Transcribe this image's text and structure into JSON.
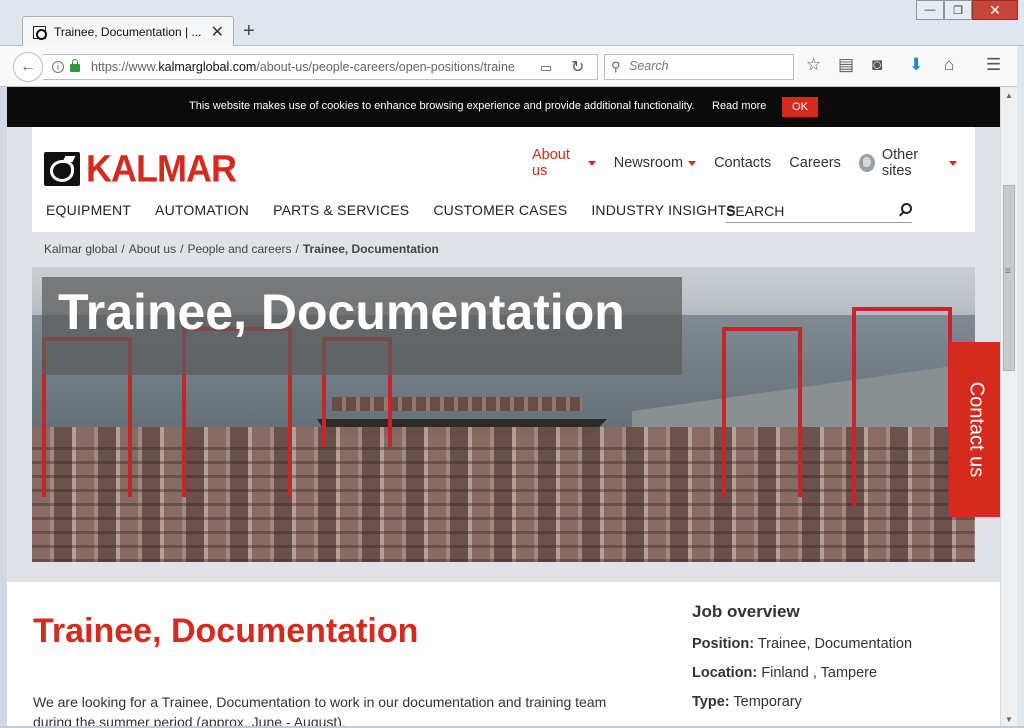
{
  "browser": {
    "tab_title": "Trainee, Documentation | ...",
    "url_prefix": "https://www.",
    "url_domain": "kalmarglobal.com",
    "url_path": "/about-us/people-careers/open-positions/traine",
    "search_placeholder": "Search"
  },
  "cookie_banner": {
    "text": "This website makes use of cookies to enhance browsing experience and provide additional functionality.",
    "read_more": "Read more",
    "ok": "OK"
  },
  "header": {
    "logo_text": "KALMAR",
    "top_nav": [
      {
        "label": "About us",
        "has_caret": true
      },
      {
        "label": "Newsroom",
        "has_caret": true
      },
      {
        "label": "Contacts",
        "has_caret": false
      },
      {
        "label": "Careers",
        "has_caret": false
      },
      {
        "label": "Other sites",
        "has_caret": true
      }
    ],
    "main_nav": [
      "EQUIPMENT",
      "AUTOMATION",
      "PARTS & SERVICES",
      "CUSTOMER CASES",
      "INDUSTRY INSIGHTS"
    ],
    "search_placeholder": "SEARCH"
  },
  "breadcrumb": {
    "items": [
      "Kalmar global",
      "About us",
      "People and careers"
    ],
    "current": "Trainee, Documentation"
  },
  "hero": {
    "title": "Trainee, Documentation"
  },
  "contact_tab": "Contact us",
  "main": {
    "title": "Trainee, Documentation",
    "intro": "We are looking for a Trainee, Documentation to work in our documentation and training team during the summer period (approx. June - August)."
  },
  "job_overview": {
    "heading": "Job overview",
    "position_label": "Position:",
    "position_value": "Trainee, Documentation",
    "location_label": "Location:",
    "location_value": "Finland , Tampere",
    "type_label": "Type:",
    "type_value": "Temporary"
  },
  "colors": {
    "brand_red": "#d52b1e",
    "cookie_bg": "#0b0b0b"
  }
}
